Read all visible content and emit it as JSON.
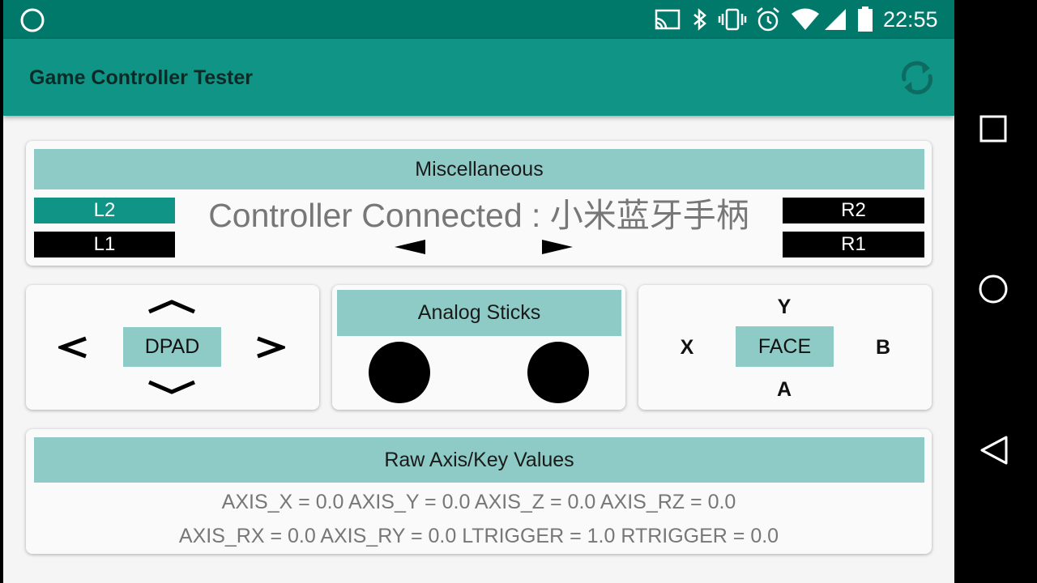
{
  "status_bar": {
    "time": "22:55"
  },
  "app_bar": {
    "title": "Game Controller Tester"
  },
  "misc": {
    "header": "Miscellaneous",
    "connection_text": "Controller Connected : 小米蓝牙手柄",
    "l2_label": "L2",
    "l1_label": "L1",
    "r2_label": "R2",
    "r1_label": "R1",
    "l2_active_color": "#0f9486",
    "inactive_color": "#000000"
  },
  "dpad": {
    "center_label": "DPAD"
  },
  "analog": {
    "header": "Analog Sticks"
  },
  "face": {
    "center_label": "FACE",
    "y_label": "Y",
    "x_label": "X",
    "b_label": "B",
    "a_label": "A"
  },
  "raw": {
    "header": "Raw Axis/Key Values",
    "line1": "AXIS_X = 0.0  AXIS_Y = 0.0  AXIS_Z = 0.0  AXIS_RZ = 0.0",
    "line2": "AXIS_RX = 0.0  AXIS_RY = 0.0  LTRIGGER = 1.0  RTRIGGER = 0.0"
  },
  "colors": {
    "accent": "#0f9486",
    "status_bar": "#00796b",
    "panel_header": "#8ecbc6"
  }
}
